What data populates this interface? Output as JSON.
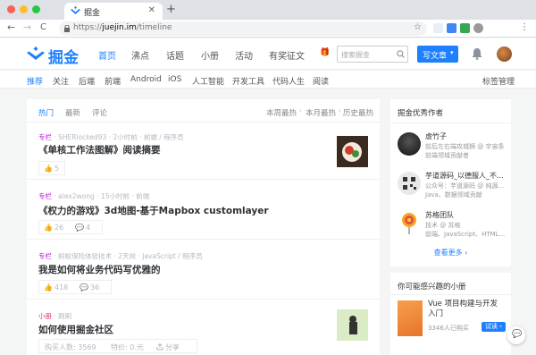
{
  "browser": {
    "tab_title": "掘金",
    "tab_close": "✕",
    "new_tab": "+",
    "url_scheme": "https://",
    "url_host": "juejin.im",
    "url_path": "/timeline",
    "back": "←",
    "forward": "→",
    "reload": "C",
    "star": "☆",
    "dot_colors": [
      "#fe5f57",
      "#febb2e",
      "#29c840"
    ]
  },
  "header": {
    "logo": "掘金",
    "nav": [
      "首页",
      "沸点",
      "话题",
      "小册",
      "活动",
      "有奖征文"
    ],
    "nav_gift": "🎁",
    "search_placeholder": "搜索掘金",
    "write_label": "写文章",
    "write_caret": "▾",
    "bell": "🔔",
    "accent": "#1e80ff"
  },
  "subnav": {
    "items": [
      "推荐",
      "关注",
      "后端",
      "前端",
      "Android",
      "iOS",
      "人工智能",
      "开发工具",
      "代码人生",
      "阅读"
    ],
    "manage": "标签管理"
  },
  "list": {
    "tabs": [
      "热门",
      "最新",
      "评论"
    ],
    "ranks": [
      "本周最热",
      "本月最热",
      "历史最热"
    ],
    "sep": "·",
    "entries": [
      {
        "tag": "专栏",
        "meta": "SHERlocked93 · 2小时前 · 前端 / 程序员",
        "title": "《单核工作法图解》阅读摘要",
        "likes": "5",
        "comments": ""
      },
      {
        "tag": "专栏",
        "meta": "alex2wong · 15小时前 · 前端",
        "title": "《权力的游戏》3d地图-基于Mapbox customlayer",
        "likes": "26",
        "comments": "4"
      },
      {
        "tag": "专栏",
        "meta": "蚂蚁保险体验技术 · 2天前 · JavaScript / 程序员",
        "title": "我是如何将业务代码写优雅的",
        "likes": "418",
        "comments": "36"
      },
      {
        "tag": "小册",
        "meta": "刷刷",
        "title": "如何使用掘金社区",
        "buyers": "购买人数: 3569",
        "price": "特价: 0.元",
        "share": "分享"
      }
    ],
    "like_icon": "👍",
    "comment_icon": "💬"
  },
  "sidebar": {
    "authors_title": "掘金优秀作者",
    "authors": [
      {
        "name": "虚竹子",
        "desc1": "前后左右端攻城狮 @ 宇宙条",
        "desc2": "前端领域贡献者"
      },
      {
        "name": "芋道源码_以德服人_不...",
        "desc1": "公众号：芋道源码 @ 纯源...",
        "desc2": "Java、数据领域贡献"
      },
      {
        "name": "苏格团队",
        "desc1": "技术 @ 苏格",
        "desc2": "前端、JavaScript、HTML..."
      }
    ],
    "more": "查看更多 ›",
    "books_title": "你可能感兴趣的小册",
    "book": {
      "title": "Vue 项目构建与开发入门",
      "meta": "3346人已购买",
      "try": "试读 ›"
    },
    "float_icon": "💬"
  }
}
